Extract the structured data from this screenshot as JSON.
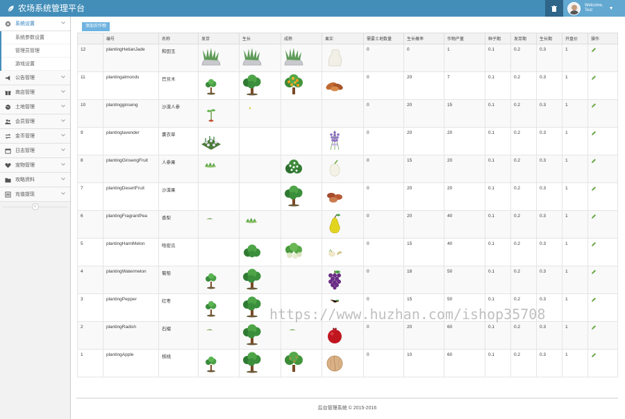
{
  "app": {
    "title": "农场系统管理平台"
  },
  "user": {
    "welcome": "Welcome,",
    "name": "Test"
  },
  "sidebar": {
    "items": [
      {
        "key": "system",
        "label": "系统设置",
        "icon": "settings-icon",
        "active": true,
        "children": [
          "系统参数设置",
          "管理员管理",
          "游戏设置"
        ]
      },
      {
        "key": "notice",
        "label": "公告管理",
        "icon": "bullhorn-icon"
      },
      {
        "key": "shop",
        "label": "商店管理",
        "icon": "gift-icon"
      },
      {
        "key": "land",
        "label": "土地管理",
        "icon": "globe-icon"
      },
      {
        "key": "member",
        "label": "会员管理",
        "icon": "users-icon"
      },
      {
        "key": "coin",
        "label": "金币管理",
        "icon": "exchange-icon"
      },
      {
        "key": "log",
        "label": "日志管理",
        "icon": "calendar-icon"
      },
      {
        "key": "pet",
        "label": "宠物管理",
        "icon": "heart-icon"
      },
      {
        "key": "guide",
        "label": "攻略资料",
        "icon": "folder-icon"
      },
      {
        "key": "recharge",
        "label": "充值提现",
        "icon": "list-icon"
      }
    ]
  },
  "main": {
    "add_button": "添加农作物",
    "columns": [
      "",
      "编号",
      "名称",
      "发芽",
      "生长",
      "成熟",
      "果实",
      "需要土地数量",
      "生长概率",
      "作物产量",
      "种子期",
      "发芽期",
      "生长期",
      "开盘价",
      "操作"
    ],
    "rows": [
      {
        "id": "12",
        "code": "plantingHetianJade",
        "name": "和田玉",
        "sprout": "rock",
        "grow": "rock",
        "mature": "rock",
        "fruit": "jade",
        "land": "0",
        "prob": "0",
        "yield": "1",
        "seed": "0.1",
        "sprout_p": "0.2",
        "grow_p": "0.3",
        "price": "1"
      },
      {
        "id": "11",
        "code": "plantingalmonds",
        "name": "巴旦木",
        "sprout": "sapling",
        "grow": "tree",
        "mature": "orange-tree",
        "fruit": "almonds",
        "land": "0",
        "prob": "20",
        "yield": "7",
        "seed": "0.1",
        "sprout_p": "0.2",
        "grow_p": "0.3",
        "price": "1"
      },
      {
        "id": "10",
        "code": "plantingginseng",
        "name": "沙漠人参",
        "sprout": "seedling",
        "grow": "dot",
        "mature": "",
        "fruit": "",
        "land": "0",
        "prob": "20",
        "yield": "15",
        "seed": "0.1",
        "sprout_p": "0.2",
        "grow_p": "0.3",
        "price": "1"
      },
      {
        "id": "9",
        "code": "plantinglavender",
        "name": "薰衣草",
        "sprout": "lavender-bed",
        "grow": "",
        "mature": "",
        "fruit": "lavender",
        "land": "0",
        "prob": "20",
        "yield": "20",
        "seed": "0.1",
        "sprout_p": "0.2",
        "grow_p": "0.3",
        "price": "1"
      },
      {
        "id": "8",
        "code": "plantingGinsengFruit",
        "name": "人参果",
        "sprout": "grass",
        "grow": "",
        "mature": "flower-bush",
        "fruit": "white-fruit",
        "land": "0",
        "prob": "15",
        "yield": "20",
        "seed": "0.1",
        "sprout_p": "0.2",
        "grow_p": "0.3",
        "price": "1"
      },
      {
        "id": "7",
        "code": "plantingDesertFruit",
        "name": "沙漠果",
        "sprout": "",
        "grow": "",
        "mature": "tree",
        "fruit": "dates",
        "land": "0",
        "prob": "20",
        "yield": "20",
        "seed": "0.1",
        "sprout_p": "0.2",
        "grow_p": "0.3",
        "price": "1"
      },
      {
        "id": "6",
        "code": "plantingFragrantPea",
        "name": "香梨",
        "sprout": "tiny",
        "grow": "grass",
        "mature": "",
        "fruit": "pear",
        "land": "0",
        "prob": "20",
        "yield": "40",
        "seed": "0.1",
        "sprout_p": "0.2",
        "grow_p": "0.3",
        "price": "1"
      },
      {
        "id": "5",
        "code": "plantingHamiMelon",
        "name": "哈密瓜",
        "sprout": "",
        "grow": "bush",
        "mature": "melon-bush",
        "fruit": "melon",
        "land": "0",
        "prob": "15",
        "yield": "40",
        "seed": "0.1",
        "sprout_p": "0.2",
        "grow_p": "0.3",
        "price": "1"
      },
      {
        "id": "4",
        "code": "plantingWatermelon",
        "name": "葡萄",
        "sprout": "sapling",
        "grow": "tree",
        "mature": "",
        "fruit": "grapes",
        "land": "0",
        "prob": "18",
        "yield": "50",
        "seed": "0.1",
        "sprout_p": "0.2",
        "grow_p": "0.3",
        "price": "1"
      },
      {
        "id": "3",
        "code": "plantingPepper",
        "name": "红枣",
        "sprout": "sapling",
        "grow": "tree",
        "mature": "",
        "fruit": "twig",
        "land": "0",
        "prob": "15",
        "yield": "50",
        "seed": "0.1",
        "sprout_p": "0.2",
        "grow_p": "0.3",
        "price": "1"
      },
      {
        "id": "2",
        "code": "plantingRadish",
        "name": "石榴",
        "sprout": "tiny",
        "grow": "tree",
        "mature": "tiny",
        "fruit": "pomegranate",
        "land": "0",
        "prob": "20",
        "yield": "60",
        "seed": "0.1",
        "sprout_p": "0.2",
        "grow_p": "0.3",
        "price": "1"
      },
      {
        "id": "1",
        "code": "plantingApple",
        "name": "核桃",
        "sprout": "sapling",
        "grow": "tree",
        "mature": "fruit-tree",
        "fruit": "walnut",
        "land": "0",
        "prob": "10",
        "yield": "60",
        "seed": "0.1",
        "sprout_p": "0.2",
        "grow_p": "0.3",
        "price": "1"
      }
    ]
  },
  "footer": {
    "text": "后台管理系统 © 2015-2016"
  },
  "watermark": "https://www.huzhan.com/ishop35708",
  "colors": {
    "navbar": "#438eb9",
    "accent": "#2b7dbc",
    "button": "#6fb3e0",
    "edit": "#69aa46"
  }
}
